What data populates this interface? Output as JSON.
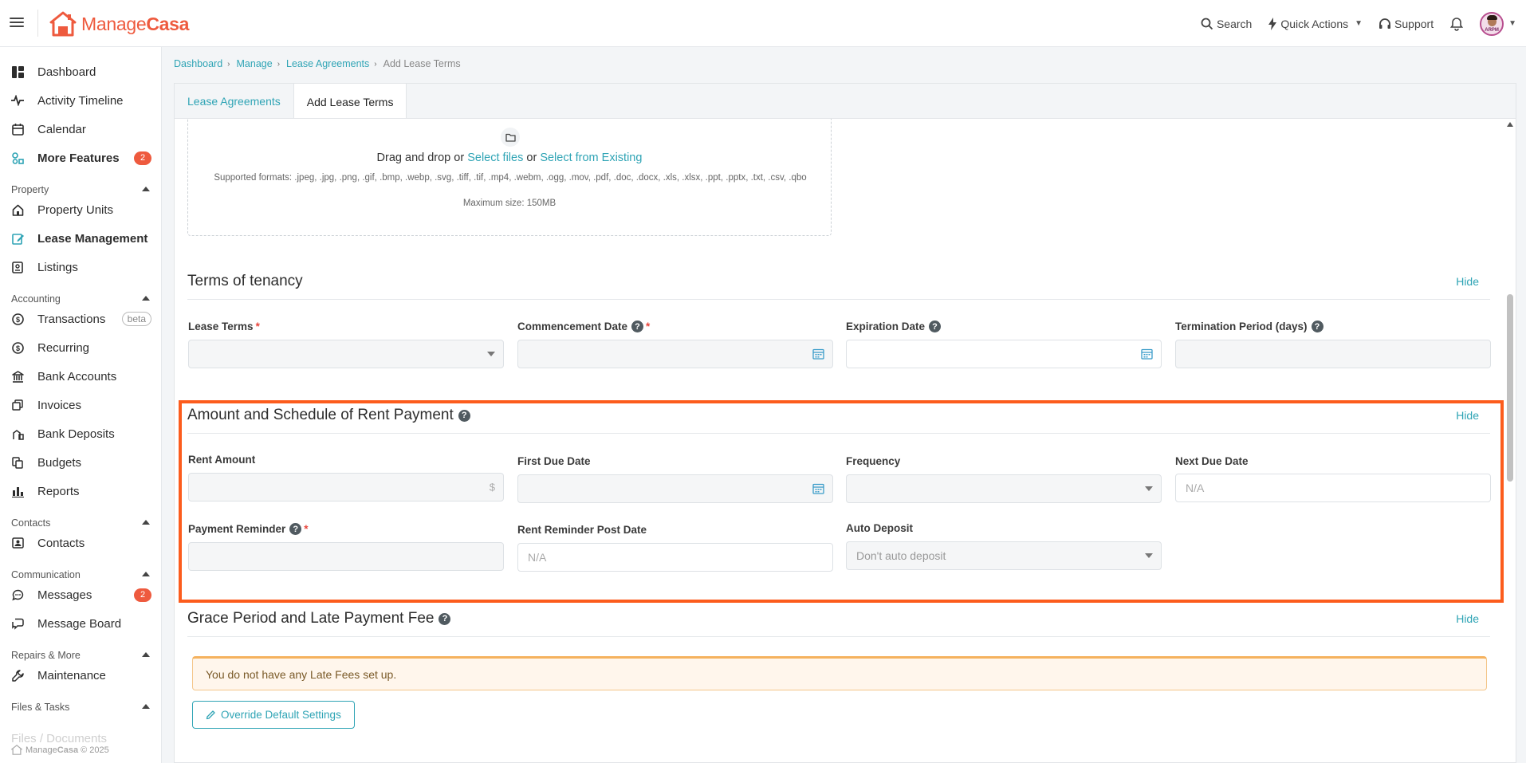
{
  "header": {
    "logo_text_regular": "Manage",
    "logo_text_bold": "Casa",
    "search_label": "Search",
    "quick_actions_label": "Quick Actions",
    "support_label": "Support",
    "avatar_initials": "ARPM"
  },
  "sidebar": {
    "top_items": [
      {
        "label": "Dashboard",
        "icon": "dashboard-icon"
      },
      {
        "label": "Activity Timeline",
        "icon": "activity-icon"
      },
      {
        "label": "Calendar",
        "icon": "calendar-icon"
      },
      {
        "label": "More Features",
        "icon": "features-icon",
        "badge": "2"
      }
    ],
    "sections": {
      "property": {
        "title": "Property",
        "items": [
          {
            "label": "Property Units",
            "icon": "home-icon"
          },
          {
            "label": "Lease Management",
            "icon": "edit-icon"
          },
          {
            "label": "Listings",
            "icon": "listing-icon"
          }
        ]
      },
      "accounting": {
        "title": "Accounting",
        "items": [
          {
            "label": "Transactions",
            "icon": "dollar-icon",
            "tag": "beta"
          },
          {
            "label": "Recurring",
            "icon": "recurring-icon"
          },
          {
            "label": "Bank Accounts",
            "icon": "bank-icon"
          },
          {
            "label": "Invoices",
            "icon": "invoice-icon"
          },
          {
            "label": "Bank Deposits",
            "icon": "deposit-icon"
          },
          {
            "label": "Budgets",
            "icon": "budget-icon"
          },
          {
            "label": "Reports",
            "icon": "reports-icon"
          }
        ]
      },
      "contacts": {
        "title": "Contacts",
        "items": [
          {
            "label": "Contacts",
            "icon": "contacts-icon"
          }
        ]
      },
      "communication": {
        "title": "Communication",
        "items": [
          {
            "label": "Messages",
            "icon": "message-icon",
            "badge": "2"
          },
          {
            "label": "Message Board",
            "icon": "board-icon"
          }
        ]
      },
      "repairs": {
        "title": "Repairs & More",
        "items": [
          {
            "label": "Maintenance",
            "icon": "wrench-icon"
          }
        ]
      },
      "files": {
        "title": "Files & Tasks"
      }
    },
    "ghost_item": "Files / Documents",
    "footer_regular": "Manage",
    "footer_bold": "Casa",
    "footer_copy": "© 2025"
  },
  "breadcrumb": {
    "items": [
      "Dashboard",
      "Manage",
      "Lease Agreements"
    ],
    "current": "Add Lease Terms"
  },
  "tabs": [
    "Lease Agreements",
    "Add Lease Terms"
  ],
  "upload": {
    "drag_text": "Drag and drop",
    "or_1": "or",
    "select_files": "Select files",
    "or_2": "or",
    "select_existing": "Select from Existing",
    "formats": "Supported formats: .jpeg, .jpg, .png, .gif, .bmp, .webp, .svg, .tiff, .tif, .mp4, .webm, .ogg, .mov, .pdf, .doc, .docx, .xls, .xlsx, .ppt, .pptx, .txt, .csv, .qbo",
    "max_size": "Maximum size: 150MB"
  },
  "terms": {
    "title": "Terms of tenancy",
    "hide": "Hide",
    "lease_terms_label": "Lease Terms",
    "commencement_label": "Commencement Date",
    "expiration_label": "Expiration Date",
    "termination_label": "Termination Period (days)"
  },
  "rent": {
    "title": "Amount and Schedule of Rent Payment",
    "hide": "Hide",
    "rent_amount_label": "Rent Amount",
    "currency_symbol": "$",
    "first_due_label": "First Due Date",
    "frequency_label": "Frequency",
    "next_due_label": "Next Due Date",
    "next_due_value": "N/A",
    "payment_reminder_label": "Payment Reminder",
    "reminder_post_label": "Rent Reminder Post Date",
    "reminder_post_value": "N/A",
    "auto_deposit_label": "Auto Deposit",
    "auto_deposit_value": "Don't auto deposit"
  },
  "grace": {
    "title": "Grace Period and Late Payment Fee",
    "hide": "Hide",
    "alert_text": "You do not have any Late Fees set up.",
    "override_button": "Override Default Settings"
  },
  "colors": {
    "accent": "#2fa4b5",
    "brand": "#ee5a3e",
    "highlight": "#fc5c1d",
    "badge": "#ee5a3e"
  }
}
